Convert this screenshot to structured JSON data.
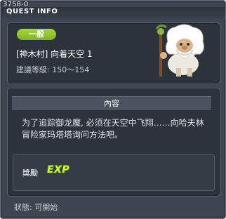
{
  "window": {
    "quest_id": "3758-0",
    "title": "QUEST INFO"
  },
  "quest": {
    "category": "一般",
    "name": "[神木村] 向着天空 1",
    "level": "建議等級: 150～154"
  },
  "content": {
    "header": "內容",
    "text": "为了追踪御龙魔, 必须在天空中飞翔……向哈夫林冒险家玛塔塔询问方法吧。"
  },
  "reward": {
    "label": "獎勵",
    "exp": "EXP"
  },
  "status": {
    "text": "狀態: 可開始"
  },
  "colors": {
    "window_bg": "#3c4550",
    "panel_bg": "#2c333c",
    "badge_green": "#8cc22a",
    "exp_yellow": "#d7f53a"
  },
  "icons": {
    "npc": "halfling-elder-npc-portrait",
    "exp": "exp-icon"
  }
}
